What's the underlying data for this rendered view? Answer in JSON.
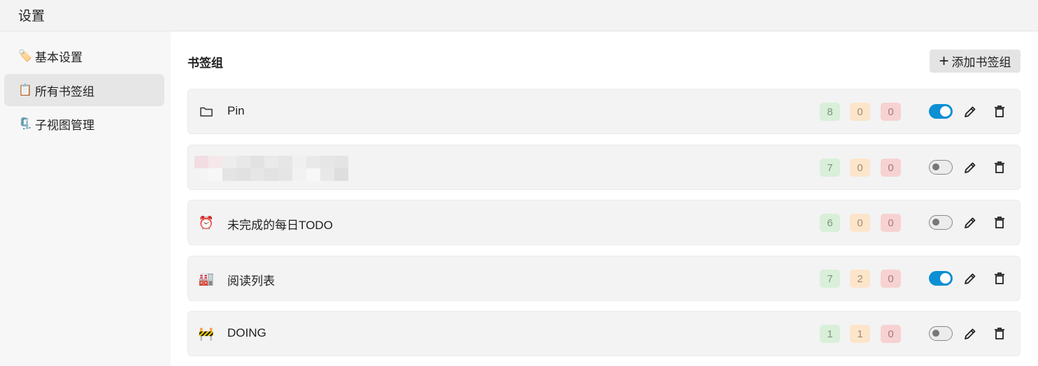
{
  "window": {
    "title": "设置"
  },
  "sidebar": {
    "items": [
      {
        "emoji": "🏷️",
        "label": "基本设置",
        "active": false
      },
      {
        "emoji": "📋",
        "label": "所有书签组",
        "active": true
      },
      {
        "emoji": "🗜️",
        "label": "子视图管理",
        "active": false
      }
    ]
  },
  "main": {
    "section_title": "书签组",
    "add_button": {
      "icon": "plus-icon",
      "label": "添加书签组"
    },
    "groups": [
      {
        "icon": "folder-icon",
        "emoji": "",
        "name": "Pin",
        "counts": [
          "8",
          "0",
          "0"
        ],
        "enabled": true
      },
      {
        "icon": "redacted",
        "emoji": "",
        "name": "",
        "counts": [
          "7",
          "0",
          "0"
        ],
        "enabled": false
      },
      {
        "icon": "alarm-clock-icon",
        "emoji": "⏰",
        "name": "未完成的每日TODO",
        "counts": [
          "6",
          "0",
          "0"
        ],
        "enabled": false
      },
      {
        "icon": "factory-icon",
        "emoji": "🏭",
        "name": "阅读列表",
        "counts": [
          "7",
          "2",
          "0"
        ],
        "enabled": true
      },
      {
        "icon": "construction-icon",
        "emoji": "🚧",
        "name": "DOING",
        "counts": [
          "1",
          "1",
          "0"
        ],
        "enabled": false
      }
    ]
  },
  "colors": {
    "toggle_on": "#0d8fd3",
    "badge_green": "#d9efd9",
    "badge_orange": "#fde5cb",
    "badge_red": "#f7d2d2"
  }
}
